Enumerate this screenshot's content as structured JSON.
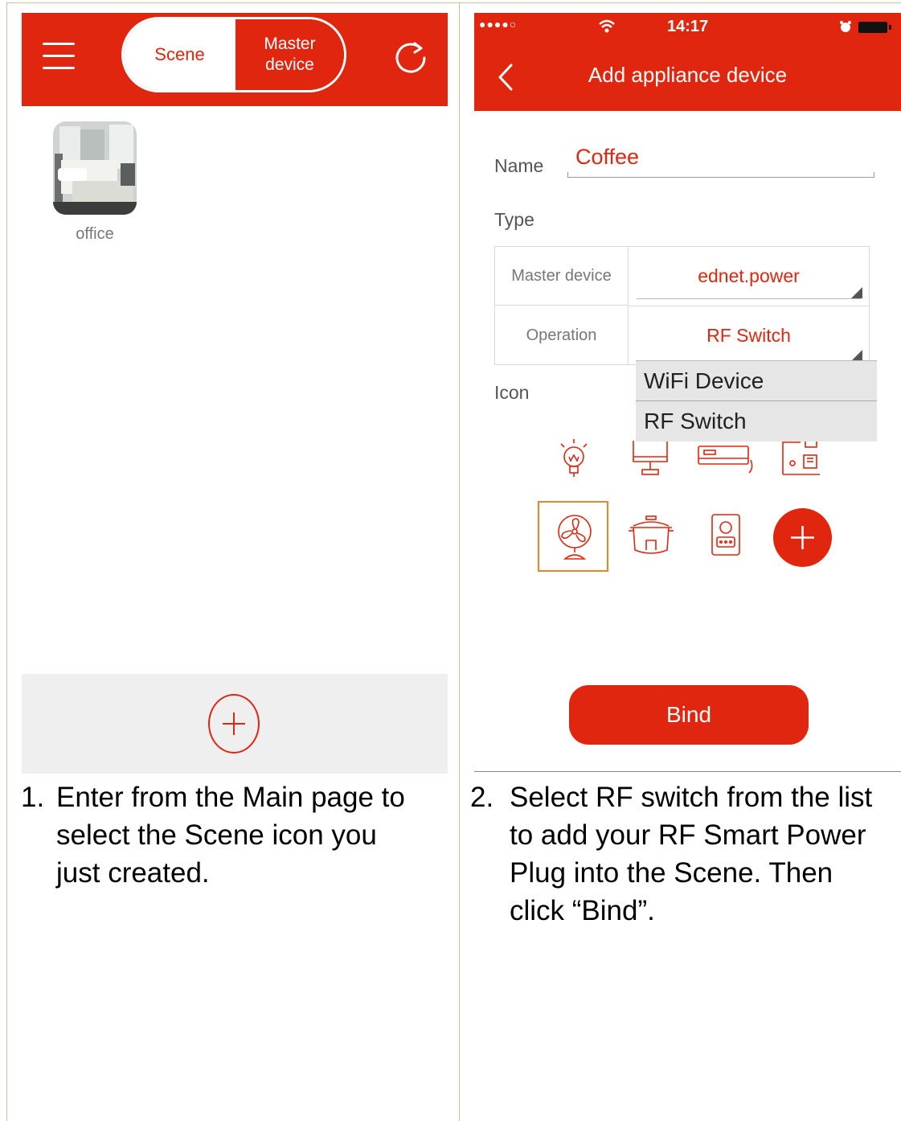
{
  "left_screen": {
    "header": {
      "menu_icon": "hamburger-icon",
      "scene_tab": "Scene",
      "master_tab_line1": "Master",
      "master_tab_line2": "device",
      "refresh_icon": "refresh-icon"
    },
    "scenes": [
      {
        "label": "office",
        "icon": "bedroom-photo"
      }
    ],
    "add_icon": "plus-circle-icon"
  },
  "right_screen": {
    "status_bar": {
      "signal": "●●●●○",
      "time": "14:17"
    },
    "header": {
      "back_icon": "chevron-left-icon",
      "title": "Add appliance device"
    },
    "form": {
      "name_label": "Name",
      "name_value": "Coffee",
      "type_label": "Type",
      "rows": [
        {
          "label": "Master device",
          "value": "ednet.power"
        },
        {
          "label": "Operation",
          "value": "RF Switch"
        }
      ],
      "icon_label": "Icon"
    },
    "dropdown_options": [
      "WiFi Device",
      "RF Switch"
    ],
    "icons": [
      "bulb-icon",
      "monitor-icon",
      "air-conditioner-icon",
      "coffee-maker-icon",
      "fan-icon",
      "rice-cooker-icon",
      "speaker-icon",
      "add-icon"
    ],
    "bind_button": "Bind"
  },
  "captions": {
    "step1_number": "1.",
    "step1_lines": [
      "Enter from the Main page to",
      "select the Scene icon you",
      "just created."
    ],
    "step2_number": "2.",
    "step2_lines": [
      "Select RF switch from the list",
      "to add your RF Smart Power",
      "Plug into the Scene. Then",
      "click “Bind”."
    ]
  },
  "colors": {
    "accent": "#e0260f",
    "selected_border": "#e9862c"
  }
}
